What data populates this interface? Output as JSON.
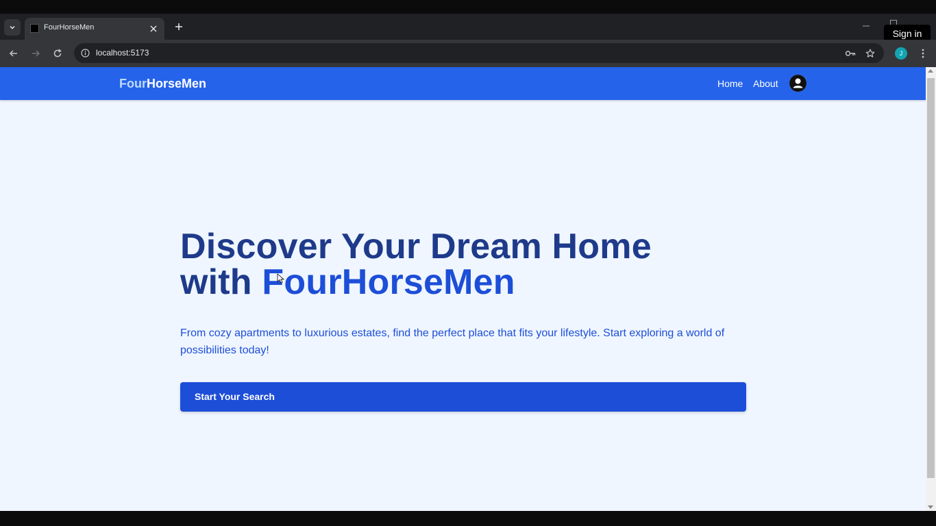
{
  "browser": {
    "tab_title": "FourHorseMen",
    "url": "localhost:5173",
    "tooltip": "Sign in",
    "profile_initial": "J"
  },
  "navbar": {
    "brand_light": "Four",
    "brand_bold": "HorseMen",
    "links": [
      "Home",
      "About"
    ]
  },
  "hero": {
    "title_line1": "Discover Your Dream Home",
    "title_line2_prefix": "with ",
    "title_line2_accent": "FourHorseMen",
    "subtitle": "From cozy apartments to luxurious estates, find the perfect place that fits your lifestyle. Start exploring a world of possibilities today!",
    "cta_label": "Start Your Search"
  },
  "colors": {
    "navbar_bg": "#2563eb",
    "page_bg": "#eff6ff",
    "title_dark": "#1e3a8a",
    "accent_blue": "#1d4ed8"
  },
  "icons": [
    "tab-list-icon",
    "close-icon",
    "plus-icon",
    "minimize-icon",
    "maximize-icon",
    "back-icon",
    "forward-icon",
    "reload-icon",
    "info-icon",
    "key-icon",
    "star-icon",
    "kebab-menu-icon",
    "user-icon"
  ]
}
